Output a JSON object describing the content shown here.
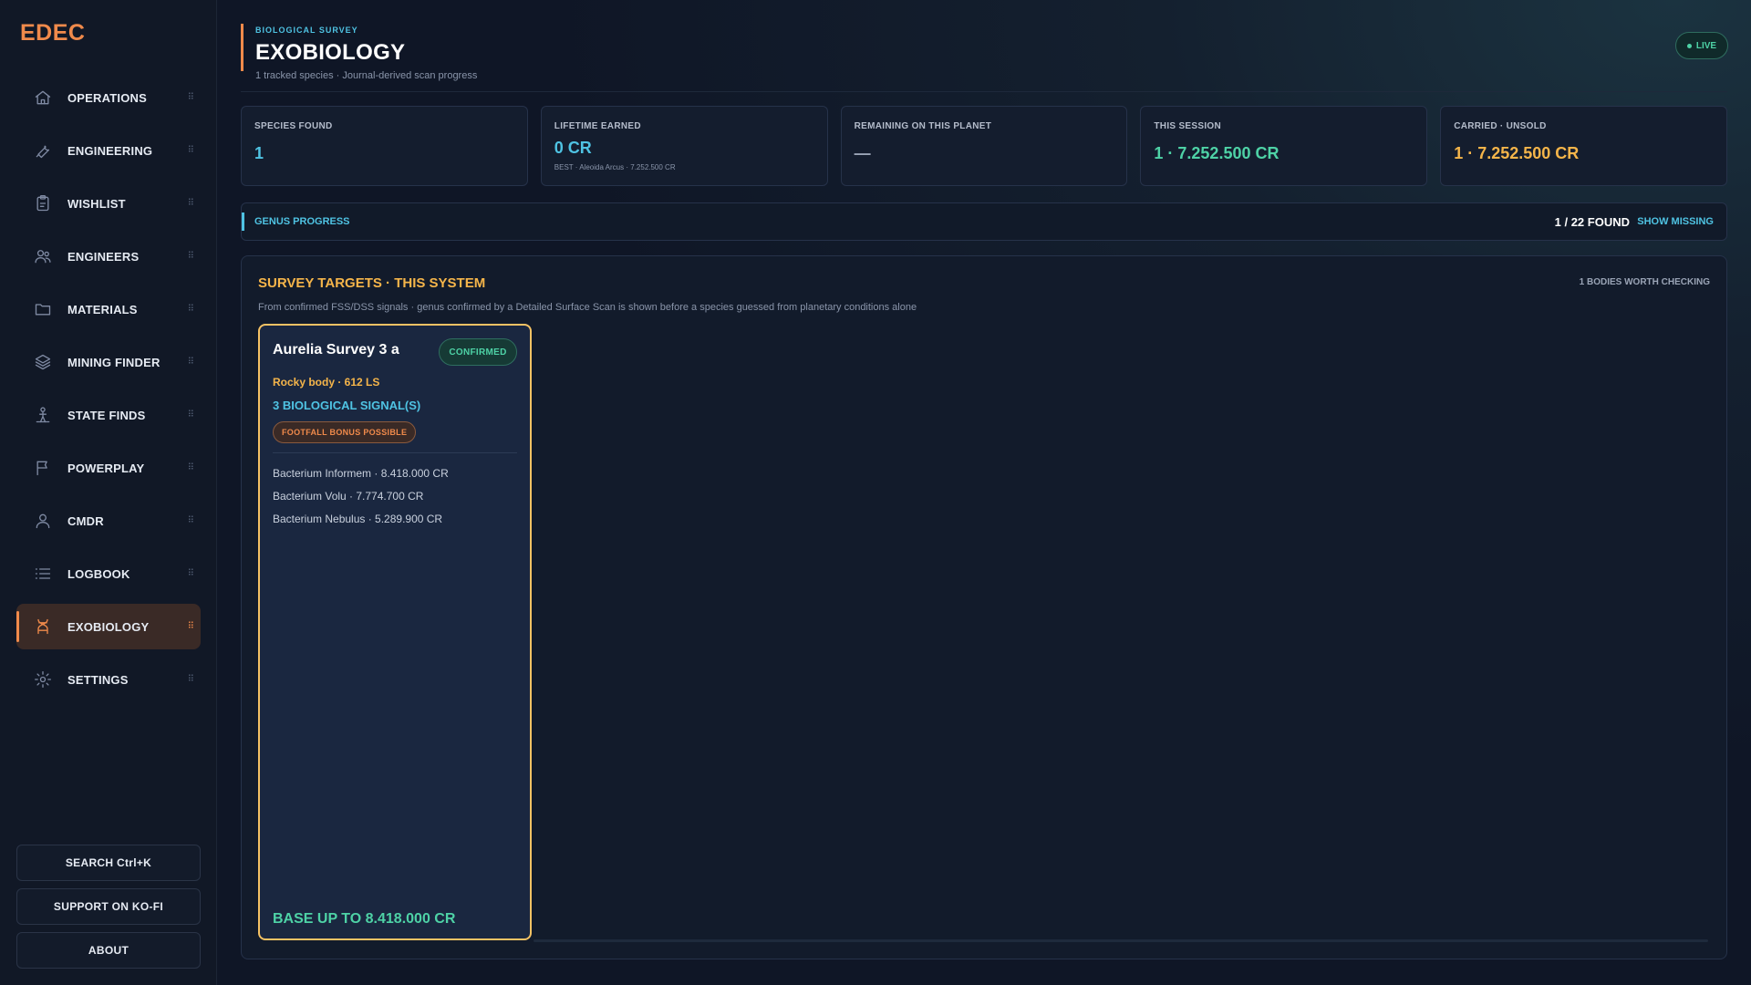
{
  "app": {
    "brand": "EDEC"
  },
  "sidebar": {
    "items": [
      {
        "label": "OPERATIONS",
        "icon": "home-icon"
      },
      {
        "label": "ENGINEERING",
        "icon": "wrench-icon"
      },
      {
        "label": "WISHLIST",
        "icon": "clipboard-icon"
      },
      {
        "label": "ENGINEERS",
        "icon": "users-icon"
      },
      {
        "label": "MATERIALS",
        "icon": "folder-icon"
      },
      {
        "label": "MINING FINDER",
        "icon": "layers-icon"
      },
      {
        "label": "STATE FINDS",
        "icon": "person-pin-icon"
      },
      {
        "label": "POWERPLAY",
        "icon": "flag-icon"
      },
      {
        "label": "CMDR",
        "icon": "user-icon"
      },
      {
        "label": "LOGBOOK",
        "icon": "list-icon"
      },
      {
        "label": "EXOBIOLOGY",
        "icon": "dna-icon",
        "active": true
      },
      {
        "label": "SETTINGS",
        "icon": "gear-icon"
      }
    ],
    "grip": "⠿",
    "buttons": {
      "search": "SEARCH  Ctrl+K",
      "support": "SUPPORT ON KO-FI",
      "about": "ABOUT"
    }
  },
  "header": {
    "eyebrow": "BIOLOGICAL SURVEY",
    "title": "EXOBIOLOGY",
    "subtitle": "1 tracked species · Journal-derived scan progress",
    "live": "LIVE"
  },
  "stats": {
    "species_found": {
      "label": "SPECIES FOUND",
      "value": "1"
    },
    "lifetime": {
      "label": "LIFETIME EARNED",
      "value": "0 CR",
      "note": "BEST · Aleoida Arcus · 7.252.500 CR"
    },
    "remaining": {
      "label": "REMAINING ON THIS PLANET",
      "value": "—"
    },
    "session": {
      "label": "THIS SESSION",
      "value": "1 · 7.252.500 CR"
    },
    "carried": {
      "label": "CARRIED · UNSOLD",
      "value": "1 · 7.252.500 CR"
    }
  },
  "genus": {
    "title": "GENUS PROGRESS",
    "count": "1 / 22 FOUND",
    "link": "SHOW MISSING"
  },
  "targets": {
    "title": "SURVEY TARGETS · THIS SYSTEM",
    "right": "1 BODIES WORTH CHECKING",
    "desc": "From confirmed FSS/DSS signals · genus confirmed by a Detailed Surface Scan is shown before a species guessed from planetary conditions alone",
    "card": {
      "name": "Aurelia Survey 3 a",
      "status": "CONFIRMED",
      "body": "Rocky body · 612 LS",
      "signals": "3 BIOLOGICAL SIGNAL(S)",
      "tag": "FOOTFALL BONUS POSSIBLE",
      "species": [
        "Bacterium Informem · 8.418.000 CR",
        "Bacterium Volu · 7.774.700 CR",
        "Bacterium Nebulus · 5.289.900 CR"
      ],
      "base": "BASE UP TO 8.418.000 CR"
    }
  },
  "colors": {
    "accent": "#f08a4b",
    "cyan": "#4fc3e3",
    "green": "#4ed2a6",
    "amber": "#f5b54a"
  }
}
